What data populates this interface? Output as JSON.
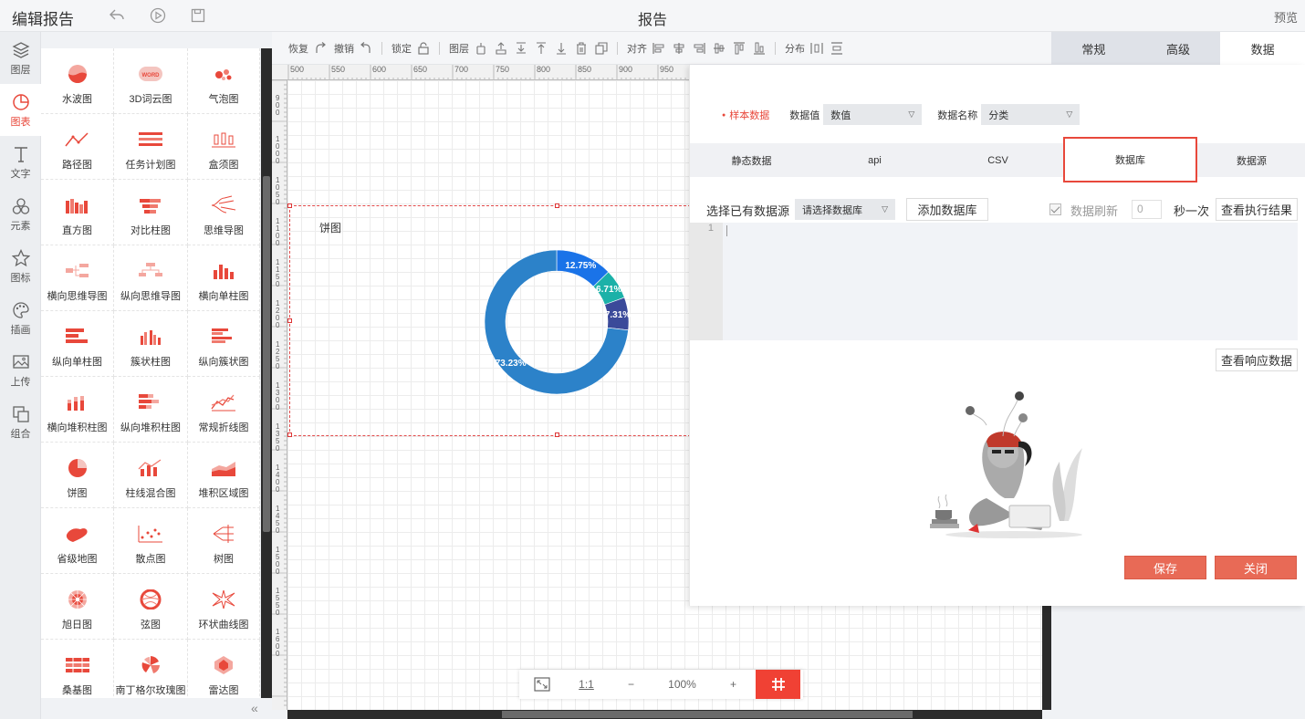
{
  "topbar": {
    "title": "编辑报告",
    "center_title": "报告",
    "preview_label": "预览"
  },
  "leftnav": [
    {
      "label": "图层",
      "icon": "layers-icon"
    },
    {
      "label": "图表",
      "icon": "chart-icon",
      "active": true
    },
    {
      "label": "文字",
      "icon": "text-icon"
    },
    {
      "label": "元素",
      "icon": "elements-icon"
    },
    {
      "label": "图标",
      "icon": "star-icon"
    },
    {
      "label": "插画",
      "icon": "palette-icon"
    },
    {
      "label": "上传",
      "icon": "image-upload-icon"
    },
    {
      "label": "组合",
      "icon": "group-icon"
    }
  ],
  "palette": [
    "水波图",
    "3D词云图",
    "气泡图",
    "路径图",
    "任务计划图",
    "盒须图",
    "直方图",
    "对比柱图",
    "思维导图",
    "横向思维导图",
    "纵向思维导图",
    "横向单柱图",
    "纵向单柱图",
    "簇状柱图",
    "纵向簇状图",
    "横向堆积柱图",
    "纵向堆积柱图",
    "常规折线图",
    "饼图",
    "柱线混合图",
    "堆积区域图",
    "省级地图",
    "散点图",
    "树图",
    "旭日图",
    "弦图",
    "环状曲线图",
    "桑基图",
    "南丁格尔玫瑰图",
    "雷达图"
  ],
  "palette_word_icon_text": "WORD",
  "toolbar": {
    "redo": "恢复",
    "undo": "撤销",
    "lock": "锁定",
    "layer": "图层",
    "align": "对齐",
    "distribute": "分布"
  },
  "ruler_top": [
    "500",
    "550",
    "600",
    "650",
    "700",
    "750",
    "800",
    "850",
    "900",
    "950"
  ],
  "ruler_left": [
    "900",
    "1000",
    "1050",
    "1100",
    "1150",
    "1200",
    "1250",
    "1300",
    "1350",
    "1400",
    "1450",
    "1500",
    "1550",
    "1600"
  ],
  "chart": {
    "title": "饼图"
  },
  "chart_data": {
    "type": "pie",
    "title": "饼图",
    "values": [
      12.75,
      6.71,
      7.31,
      73.23
    ],
    "labels": [
      "12.75%",
      "6.71%",
      "7.31%",
      "73.23%"
    ],
    "colors": [
      "#1a73e8",
      "#1bb1a8",
      "#3b4a9a",
      "#2c82c9"
    ],
    "donut": true
  },
  "zoombar": {
    "fit_label": "⤢",
    "ratio_label": "1:1",
    "minus": "−",
    "zoom": "100%",
    "plus": "+",
    "grid": "#"
  },
  "right_tabs": [
    {
      "label": "常规"
    },
    {
      "label": "高级"
    },
    {
      "label": "数据",
      "active": true
    }
  ],
  "panel": {
    "sample_data": "样本数据",
    "value_label": "数据值",
    "value_select": "数值",
    "name_label": "数据名称",
    "name_select": "分类",
    "source_tabs": [
      "静态数据",
      "api",
      "CSV",
      "数据库",
      "数据源"
    ],
    "active_source_tab": "数据库",
    "select_existing": "选择已有数据源",
    "db_select_placeholder": "请选择数据库",
    "add_db": "添加数据库",
    "refresh_label": "数据刷新",
    "refresh_value": "0",
    "per_second": "秒一次",
    "view_result": "查看执行结果",
    "line_number": "1",
    "view_response": "查看响应数据",
    "save": "保存",
    "close": "关闭"
  }
}
